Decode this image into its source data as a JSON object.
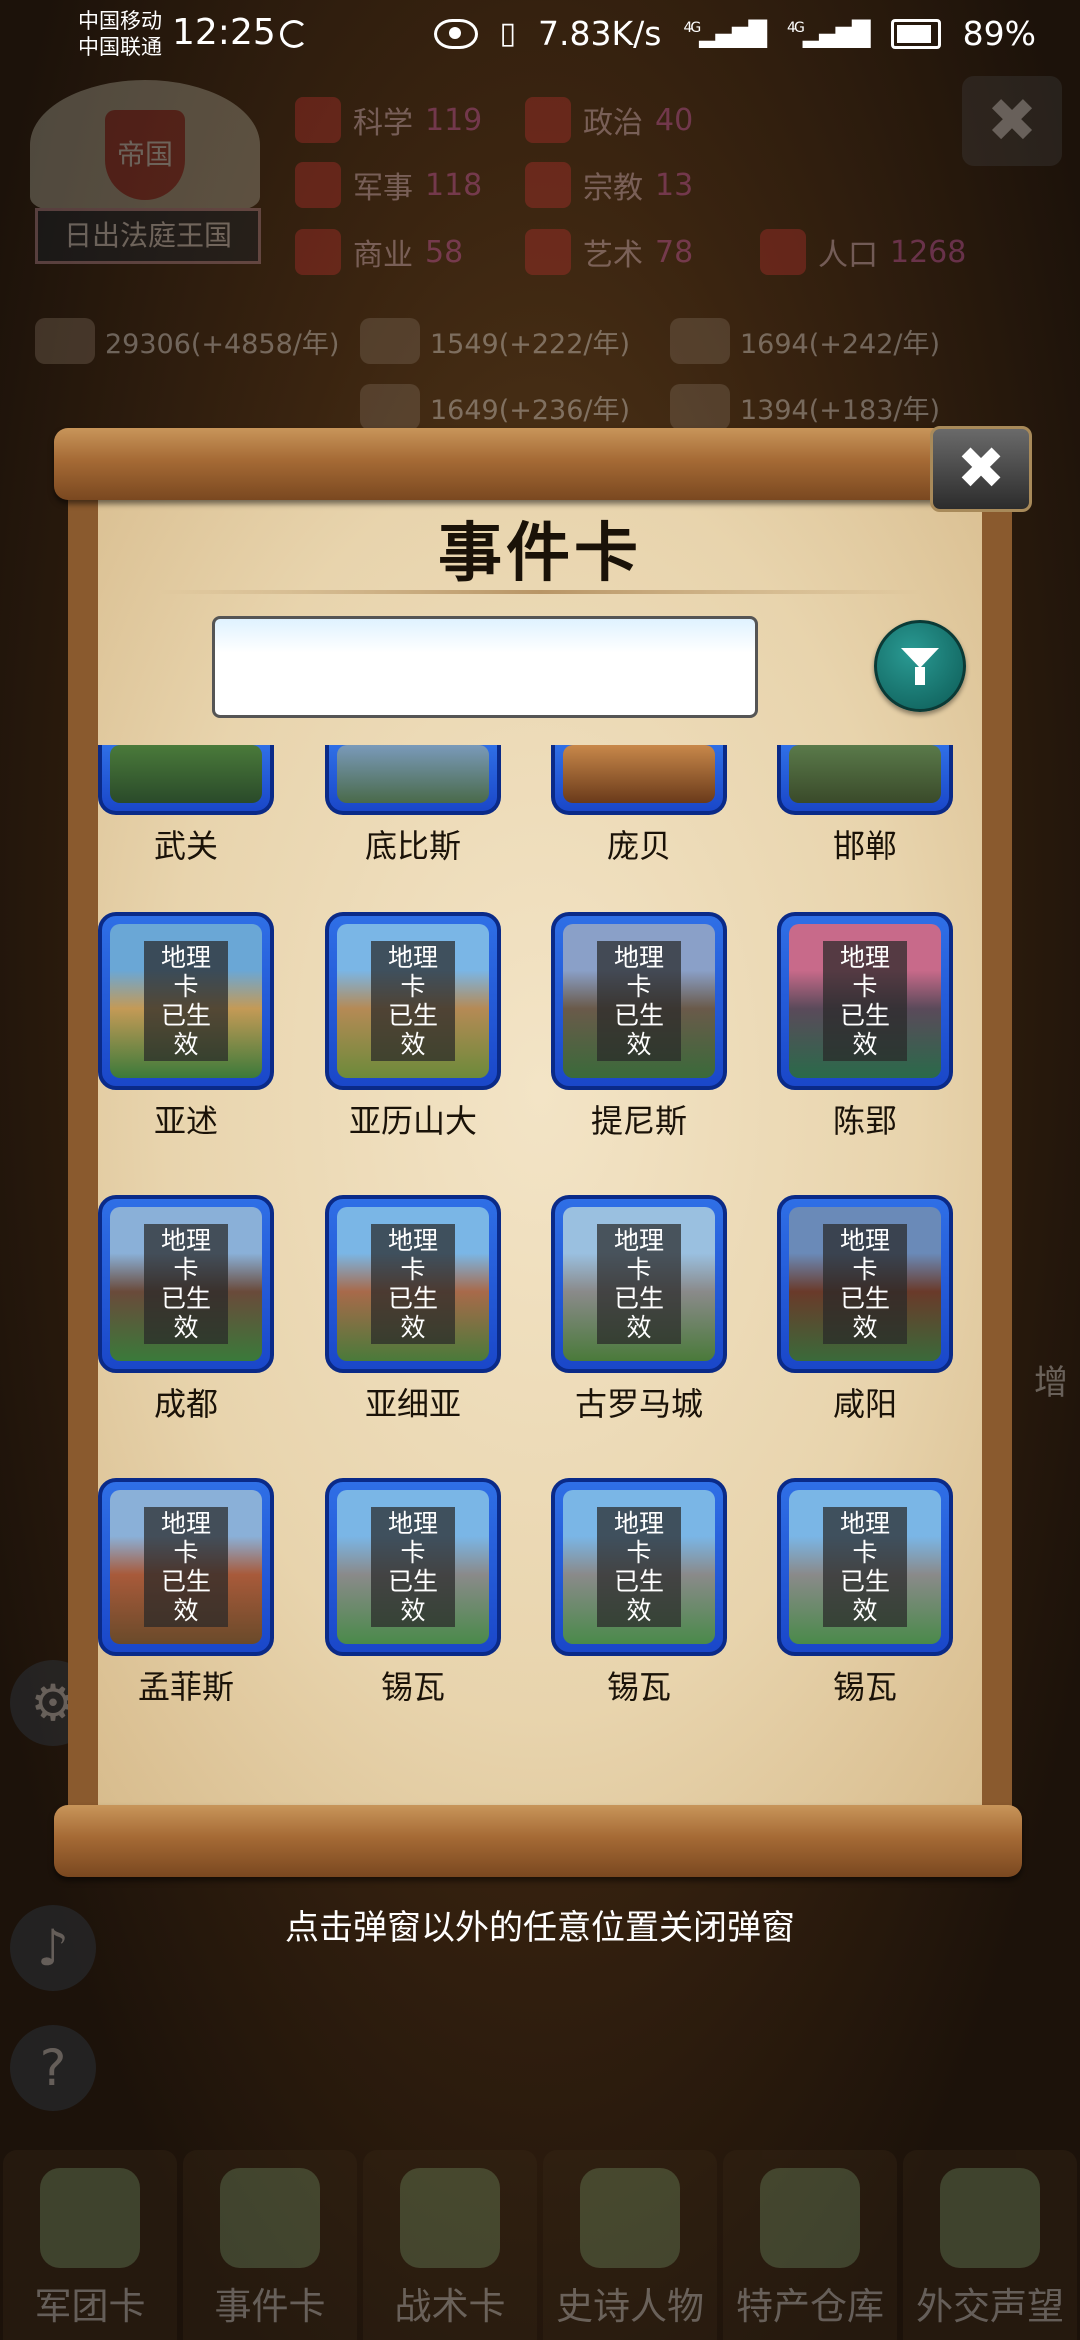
{
  "status": {
    "carrier1": "中国移动",
    "carrier2": "中国联通",
    "time": "12:25",
    "speed": "7.83K/s",
    "net1": "4G",
    "net2": "4G",
    "battery": "89%"
  },
  "hud": {
    "crest_title": "帝国",
    "kingdom": "日出法庭王国",
    "stats": [
      {
        "label": "科学",
        "value": "119"
      },
      {
        "label": "政治",
        "value": "40"
      },
      {
        "label": "军事",
        "value": "118"
      },
      {
        "label": "宗教",
        "value": "13"
      },
      {
        "label": "商业",
        "value": "58"
      },
      {
        "label": "艺术",
        "value": "78"
      },
      {
        "label": "人口",
        "value": "1268"
      }
    ],
    "resources": [
      "29306(+4858/年)",
      "1549(+222/年)",
      "1694(+242/年)",
      "1649(+236/年)",
      "1394(+183/年)"
    ],
    "close_glyph": "✖",
    "help_glyph": "?",
    "side_right_text": "增"
  },
  "modal": {
    "title": "事件卡",
    "close_glyph": "✖",
    "search_value": "",
    "search_placeholder": "",
    "badge_line1": "地理卡",
    "badge_line2": "已生效",
    "top_row": [
      "武关",
      "底比斯",
      "庞贝",
      "邯郸"
    ],
    "cards": [
      {
        "name": "亚述",
        "colors": [
          "#6aa7d6",
          "#c49a56",
          "#3b7a3a"
        ]
      },
      {
        "name": "亚历山大",
        "colors": [
          "#7ab6e6",
          "#b58a55",
          "#6c8a3a"
        ]
      },
      {
        "name": "提尼斯",
        "colors": [
          "#8aa0c8",
          "#6a5a4a",
          "#3a6a3a"
        ]
      },
      {
        "name": "陈郢",
        "colors": [
          "#c86a8a",
          "#5a4a5a",
          "#2a6a4a"
        ]
      },
      {
        "name": "成都",
        "colors": [
          "#8ab0d8",
          "#6a4a3a",
          "#3a7a3a"
        ]
      },
      {
        "name": "亚细亚",
        "colors": [
          "#7ab6e6",
          "#a86a4a",
          "#4a7a3a"
        ]
      },
      {
        "name": "古罗马城",
        "colors": [
          "#9ac0e0",
          "#8a8a8a",
          "#4a7a3a"
        ]
      },
      {
        "name": "咸阳",
        "colors": [
          "#6a8ab8",
          "#6a3a2a",
          "#3a6a3a"
        ]
      },
      {
        "name": "孟菲斯",
        "colors": [
          "#8ab0d8",
          "#a85a3a",
          "#6a4a2a"
        ]
      },
      {
        "name": "锡瓦",
        "colors": [
          "#7ab6e6",
          "#8a8a8a",
          "#4a8a4a"
        ]
      },
      {
        "name": "锡瓦",
        "colors": [
          "#7ab6e6",
          "#8a8a8a",
          "#4a8a4a"
        ]
      },
      {
        "name": "锡瓦",
        "colors": [
          "#7ab6e6",
          "#8a8a8a",
          "#4a8a4a"
        ]
      }
    ],
    "hint": "点击弹窗以外的任意位置关闭弹窗"
  },
  "nav": [
    "军团卡",
    "事件卡",
    "战术卡",
    "史诗人物",
    "特产仓库",
    "外交声望"
  ]
}
